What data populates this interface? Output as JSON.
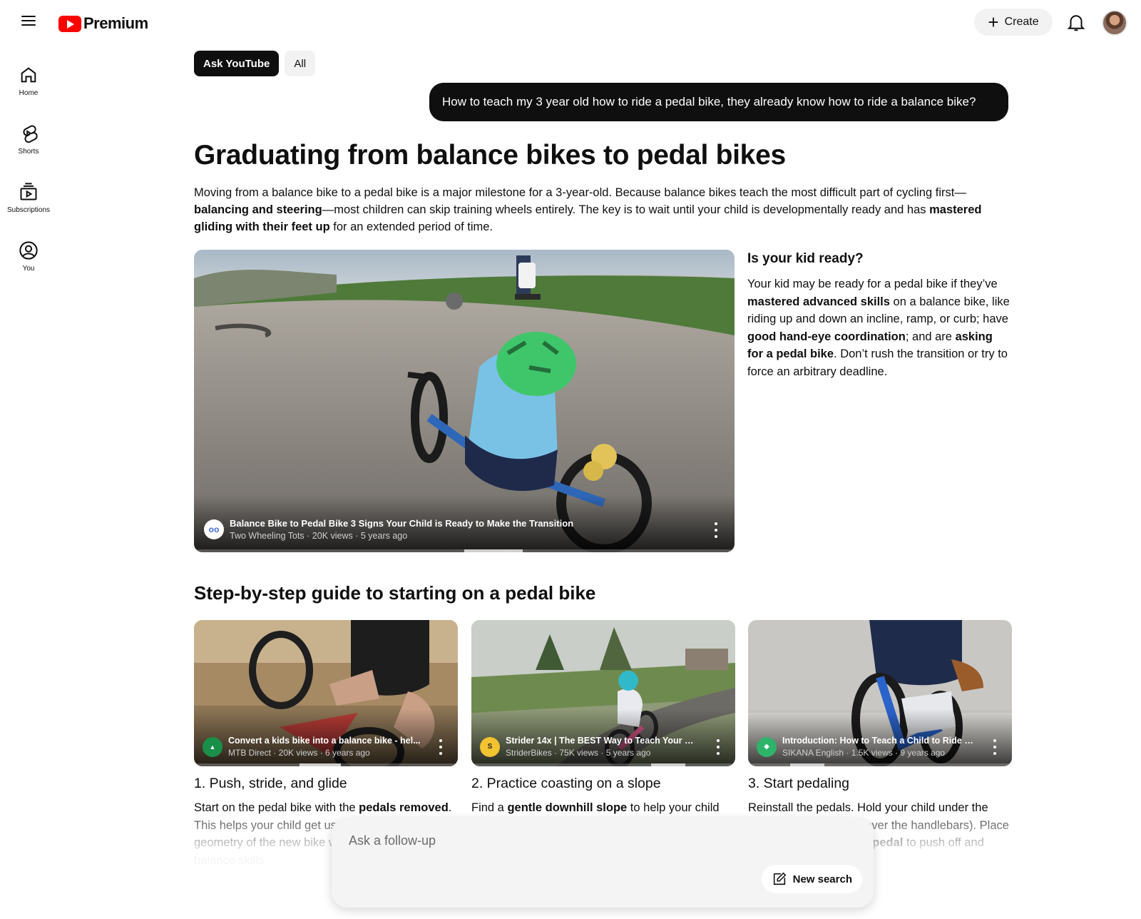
{
  "header": {
    "brand": "Premium",
    "create_label": "Create"
  },
  "sidebar": {
    "items": [
      {
        "label": "Home"
      },
      {
        "label": "Shorts"
      },
      {
        "label": "Subscriptions"
      },
      {
        "label": "You"
      }
    ]
  },
  "chips": [
    {
      "label": "Ask YouTube"
    },
    {
      "label": "All"
    }
  ],
  "query": "How to teach my 3 year old how to ride a pedal bike, they already know how to ride a balance bike?",
  "headline": "Graduating from balance bikes to pedal bikes",
  "intro": {
    "part1": "Moving from a balance bike to a pedal bike is a major milestone for a 3-year-old. Because balance bikes teach the most difficult part of cycling first—",
    "bold1": "balancing and steering",
    "part2": "—most children can skip training wheels entirely. The key is to wait until your child is developmentally ready and has ",
    "bold2": "mastered gliding with their feet up",
    "part3": " for an extended period of time."
  },
  "main_video": {
    "title": "Balance Bike to Pedal Bike 3 Signs Your Child is Ready to Make the Transition",
    "meta": "Two Wheeling Tots · 20K views · 5 years ago",
    "progress_fraction": 0.5
  },
  "ready_card": {
    "title": "Is your kid ready?",
    "t1": "Your kid may be ready for a pedal bike if they’ve ",
    "b1": "mastered advanced skills",
    "t2": " on a balance bike, like riding up and down an incline, ramp, or curb; have ",
    "b2": "good hand-eye coordination",
    "t3": "; and are ",
    "b3": "asking for a pedal bike",
    "t4": ". Don’t rush the transition or try to force an arbitrary deadline."
  },
  "section_title": "Step-by-step guide to starting on a pedal bike",
  "steps": [
    {
      "video_title": "Convert a kids bike into a balance bike - hel...",
      "video_meta": "MTB Direct · 20K views · 6 years ago",
      "heading": "1. Push, stride, and glide",
      "t1": "Start on the pedal bike with the ",
      "b1": "pedals removed",
      "t2": ". This helps your child get used to the weight and geometry of the new bike while using their familiar balance skills."
    },
    {
      "video_title": "Strider 14x | The BEST Way to Teach Your C...",
      "video_meta": "StriderBikes · 75K views · 5 years ago",
      "heading": "2. Practice coasting on a slope",
      "t1": "Find a ",
      "b1": "gentle downhill slope",
      "t2": " to help your child gain momentum without pedaling. Encourage them to coast with their feet up."
    },
    {
      "video_title": "Introduction: How to Teach a Child to Ride a...",
      "video_meta": "SIKANA English · 1.5K views · 9 years ago",
      "heading": "3. Start pedaling",
      "t1": "Reinstall the pedals. Hold your child under the arms or by the back (never the handlebars). Place their foot on the ",
      "b1": "higher pedal",
      "t2": " to push off and build momentum."
    }
  ],
  "followup": {
    "placeholder": "Ask a follow-up",
    "new_search_label": "New search"
  },
  "colors": {
    "brand_red": "#ff0000",
    "chip_active": "#0f0f0f",
    "query_bubble": "#0f0f0f"
  },
  "icons": [
    "menu-icon",
    "youtube-logo-icon",
    "plus-icon",
    "bell-icon",
    "home-icon",
    "shorts-icon",
    "subscriptions-icon",
    "you-icon",
    "more-vert-icon",
    "edit-icon"
  ]
}
